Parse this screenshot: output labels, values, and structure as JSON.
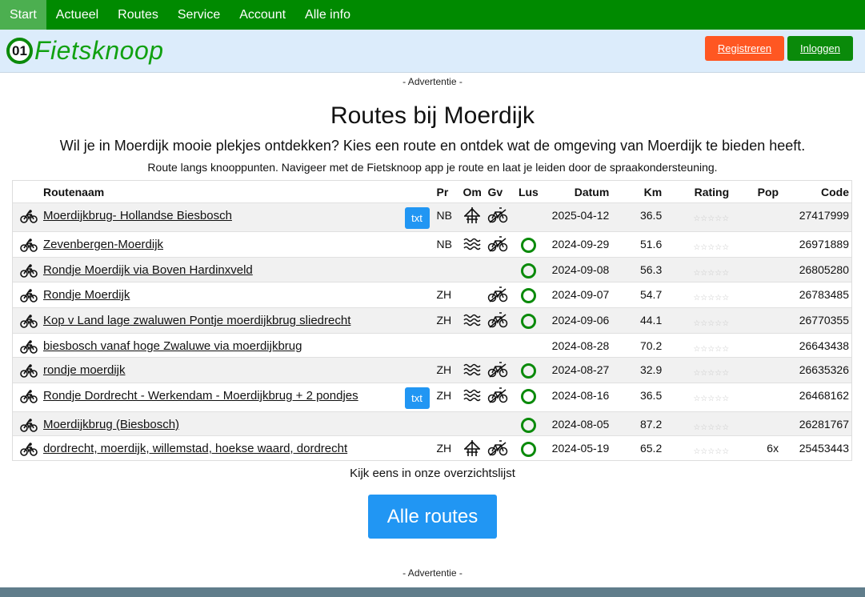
{
  "nav": [
    "Start",
    "Actueel",
    "Routes",
    "Service",
    "Account",
    "Alle info"
  ],
  "logo": {
    "number": "01",
    "text": "Fietsknoop"
  },
  "header": {
    "register": "Registreren",
    "login": "Inloggen"
  },
  "ad_label": "- Advertentie -",
  "title": "Routes bij Moerdijk",
  "subtitle": "Wil je in Moerdijk mooie plekjes ontdekken? Kies een route en ontdek wat de omgeving van Moerdijk te bieden heeft.",
  "subtitle2": "Route langs knooppunten. Navigeer met de Fietsknoop app je route en laat je leiden door de spraakondersteuning.",
  "columns": {
    "name": "Routenaam",
    "pr": "Pr",
    "om": "Om",
    "gv": "Gv",
    "lus": "Lus",
    "date": "Datum",
    "km": "Km",
    "rating": "Rating",
    "pop": "Pop",
    "code": "Code"
  },
  "txt_label": "txt",
  "stars": "☆☆☆☆☆",
  "routes": [
    {
      "name": "Moerdijkbrug- Hollandse Biesbosch",
      "txt": true,
      "pr": "NB",
      "om": "bridge",
      "gv": true,
      "lus": false,
      "date": "2025-04-12",
      "km": "36.5",
      "pop": "",
      "code": "27417999"
    },
    {
      "name": "Zevenbergen-Moerdijk",
      "txt": false,
      "pr": "NB",
      "om": "water",
      "gv": true,
      "lus": true,
      "date": "2024-09-29",
      "km": "51.6",
      "pop": "",
      "code": "26971889"
    },
    {
      "name": "Rondje Moerdijk via Boven Hardinxveld",
      "txt": false,
      "pr": "",
      "om": "",
      "gv": false,
      "lus": true,
      "date": "2024-09-08",
      "km": "56.3",
      "pop": "",
      "code": "26805280"
    },
    {
      "name": "Rondje Moerdijk",
      "txt": false,
      "pr": "ZH",
      "om": "",
      "gv": true,
      "lus": true,
      "date": "2024-09-07",
      "km": "54.7",
      "pop": "",
      "code": "26783485"
    },
    {
      "name": "Kop v Land lage zwaluwen Pontje moerdijkbrug sliedrecht",
      "txt": false,
      "pr": "ZH",
      "om": "water",
      "gv": true,
      "lus": true,
      "date": "2024-09-06",
      "km": "44.1",
      "pop": "",
      "code": "26770355"
    },
    {
      "name": "biesbosch vanaf hoge Zwaluwe via moerdijkbrug",
      "txt": false,
      "pr": "",
      "om": "",
      "gv": false,
      "lus": false,
      "date": "2024-08-28",
      "km": "70.2",
      "pop": "",
      "code": "26643438"
    },
    {
      "name": "rondje moerdijk",
      "txt": false,
      "pr": "ZH",
      "om": "water",
      "gv": true,
      "lus": true,
      "date": "2024-08-27",
      "km": "32.9",
      "pop": "",
      "code": "26635326"
    },
    {
      "name": "Rondje Dordrecht - Werkendam - Moerdijkbrug + 2 pondjes",
      "txt": true,
      "pr": "ZH",
      "om": "water",
      "gv": true,
      "lus": true,
      "date": "2024-08-16",
      "km": "36.5",
      "pop": "",
      "code": "26468162"
    },
    {
      "name": "Moerdijkbrug (Biesbosch)",
      "txt": false,
      "pr": "",
      "om": "",
      "gv": false,
      "lus": true,
      "date": "2024-08-05",
      "km": "87.2",
      "pop": "",
      "code": "26281767"
    },
    {
      "name": "dordrecht, moerdijk, willemstad, hoekse waard, dordrecht",
      "txt": false,
      "pr": "ZH",
      "om": "bridge",
      "gv": true,
      "lus": true,
      "date": "2024-05-19",
      "km": "65.2",
      "pop": "6x",
      "code": "25453443"
    }
  ],
  "more_text": "Kijk eens in onze overzichtslijst",
  "all_routes": "Alle routes"
}
